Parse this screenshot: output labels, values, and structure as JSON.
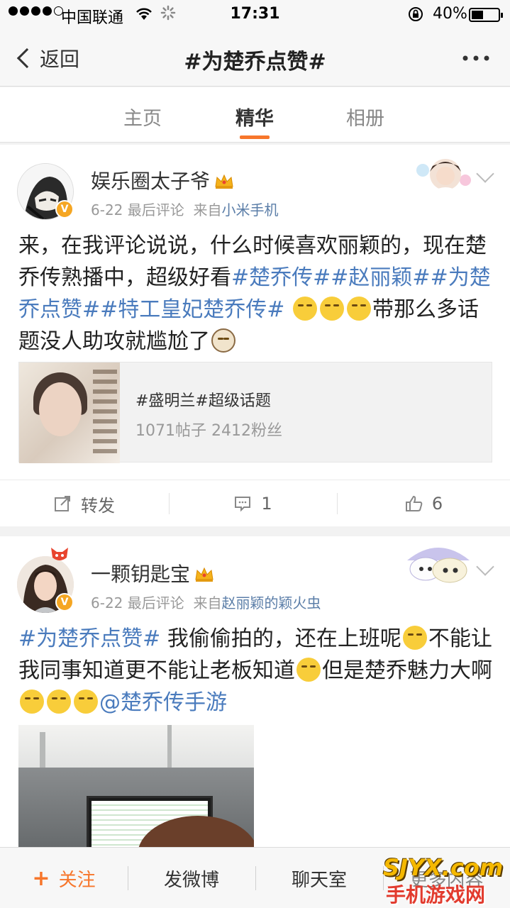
{
  "status_bar": {
    "carrier": "中国联通",
    "time": "17:31",
    "battery": "40%"
  },
  "nav": {
    "back_label": "返回",
    "title": "#为楚乔点赞#"
  },
  "tabs": [
    {
      "label": "主页",
      "active": false
    },
    {
      "label": "精华",
      "active": true
    },
    {
      "label": "相册",
      "active": false
    }
  ],
  "posts": [
    {
      "user": "娱乐圈太子爷",
      "date": "6-22",
      "meta_mid": "最后评论",
      "meta_from": "来自",
      "source": "小米手机",
      "text_1": "来，在我评论说说，什么时候喜欢丽颖的，现在楚乔传熟播中，超级好看",
      "tag_1": "#楚乔传#",
      "tag_2": "#赵丽颖#",
      "tag_3": "#为楚乔点赞#",
      "tag_4": "#特工皇妃楚乔传#",
      "text_2": "带那么多话题没人助攻就尴尬了",
      "repost": {
        "title": "#盛明兰#超级话题",
        "stats": "1071帖子 2412粉丝"
      },
      "actions": {
        "repost_label": "转发",
        "comment_count": "1",
        "like_count": "6"
      }
    },
    {
      "user": "一颗钥匙宝",
      "date": "6-22",
      "meta_mid": "最后评论",
      "meta_from": "来自",
      "source": "赵丽颖的颖火虫",
      "tag_1": "#为楚乔点赞#",
      "text_1": " 我偷偷拍的，还在上班呢",
      "text_2": "不能让我同事知道更不能让老板知道",
      "text_3": "但是楚乔魅力大啊",
      "mention": "@楚乔传手游"
    }
  ],
  "bottom_bar": {
    "follow": "关注",
    "post": "发微博",
    "chat": "聊天室",
    "more": "更多内容"
  },
  "watermark": {
    "line1": "SJYX.com",
    "line2": "手机游戏网"
  },
  "colors": {
    "accent": "#f7762b",
    "link": "#4a7bbd",
    "badge": "#f5a623"
  }
}
